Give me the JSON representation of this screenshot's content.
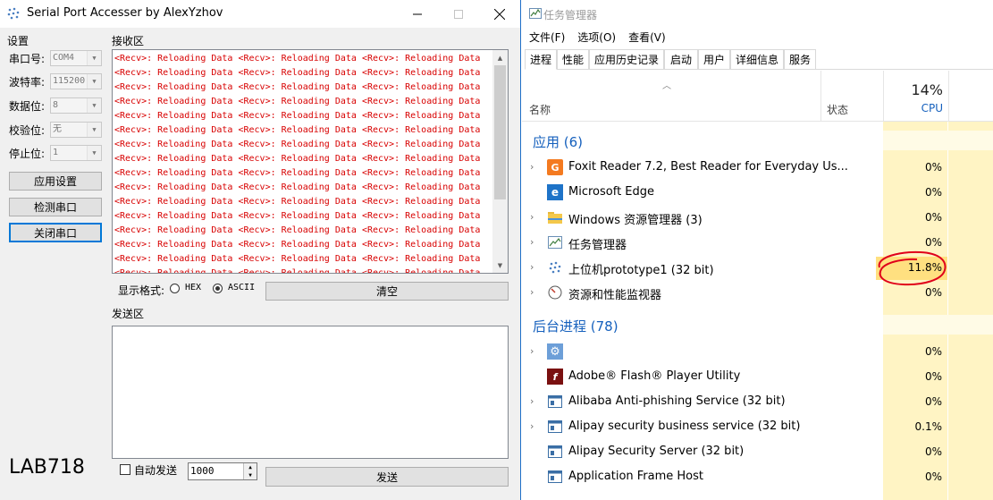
{
  "serial_app": {
    "title": "Serial Port Accesser by AlexYzhov",
    "settings_label": "设置",
    "fields": [
      {
        "label": "串口号:",
        "value": "COM4"
      },
      {
        "label": "波特率:",
        "value": "115200"
      },
      {
        "label": "数据位:",
        "value": "8"
      },
      {
        "label": "校验位:",
        "value": "无"
      },
      {
        "label": "停止位:",
        "value": "1"
      }
    ],
    "buttons": {
      "apply": "应用设置",
      "detect": "检测串口",
      "close": "关闭串口"
    },
    "receive_label": "接收区",
    "receive_line": "<Recv>: Reloading Data <Recv>: Reloading Data <Recv>: Reloading Data",
    "display_format_label": "显示格式:",
    "hex_label": "HEX",
    "ascii_label": "ASCII",
    "clear_button": "清空",
    "send_label": "发送区",
    "auto_send_label": "自动发送",
    "interval_value": "1000",
    "send_button": "发送",
    "lab_label": "LAB718"
  },
  "task_manager": {
    "title": "任务管理器",
    "menu": [
      "文件(F)",
      "选项(O)",
      "查看(V)"
    ],
    "tabs": [
      "进程",
      "性能",
      "应用历史记录",
      "启动",
      "用户",
      "详细信息",
      "服务"
    ],
    "header": {
      "name": "名称",
      "status": "状态",
      "cpu_percent": "14%",
      "cpu": "CPU"
    },
    "apps_group": "应用 (6)",
    "apps": [
      {
        "name": "Foxit Reader 7.2, Best Reader for Everyday Us...",
        "cpu": "0%",
        "icon": "foxit-icon"
      },
      {
        "name": "Microsoft Edge",
        "cpu": "0%",
        "icon": "edge-icon"
      },
      {
        "name": "Windows 资源管理器 (3)",
        "cpu": "0%",
        "icon": "folder-icon"
      },
      {
        "name": "任务管理器",
        "cpu": "0%",
        "icon": "task-manager-icon"
      },
      {
        "name": "上位机prototype1 (32 bit)",
        "cpu": "11.8%",
        "icon": "serial-app-icon"
      },
      {
        "name": "资源和性能监视器",
        "cpu": "0%",
        "icon": "resource-monitor-icon"
      }
    ],
    "bg_group": "后台进程 (78)",
    "bg": [
      {
        "name": "",
        "cpu": "0%",
        "icon": "gear-icon"
      },
      {
        "name": "Adobe® Flash® Player Utility",
        "cpu": "0%",
        "icon": "flash-icon"
      },
      {
        "name": "Alibaba Anti-phishing Service (32 bit)",
        "cpu": "0%",
        "icon": "service-icon"
      },
      {
        "name": "Alipay security business service (32 bit)",
        "cpu": "0.1%",
        "icon": "service-icon"
      },
      {
        "name": "Alipay Security Server (32 bit)",
        "cpu": "0%",
        "icon": "service-icon"
      },
      {
        "name": "Application Frame Host",
        "cpu": "0%",
        "icon": "service-icon"
      }
    ]
  },
  "colors": {
    "recv_text": "#d80000",
    "group_header": "#1560bd",
    "cpu_bg": "#fff4c4",
    "highlight_circle": "#e0001a"
  }
}
